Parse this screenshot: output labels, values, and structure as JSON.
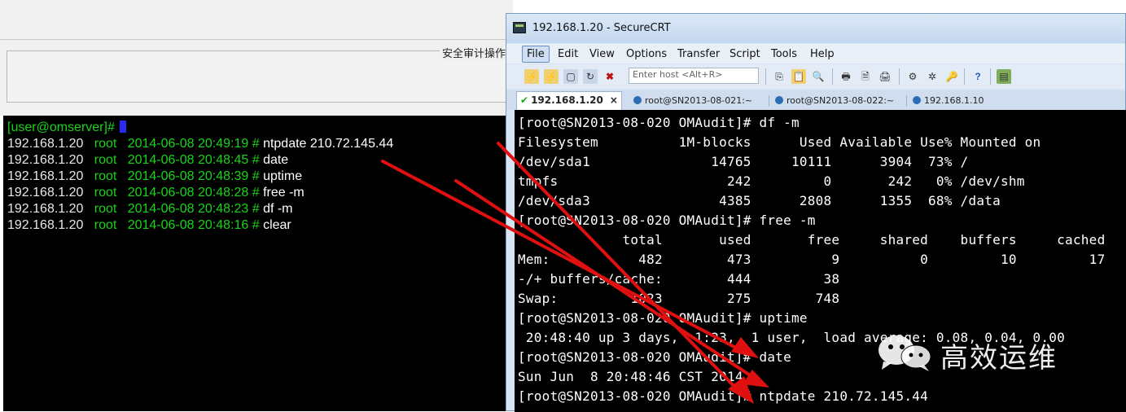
{
  "left_window": {
    "legend": "安全审计操作",
    "prompt": "[user@omserver]#",
    "rows": [
      {
        "ip": "192.168.1.20",
        "user": "root",
        "time": "2014-06-08 20:49:19 #",
        "cmd": "ntpdate 210.72.145.44"
      },
      {
        "ip": "192.168.1.20",
        "user": "root",
        "time": "2014-06-08 20:48:45 #",
        "cmd": "date"
      },
      {
        "ip": "192.168.1.20",
        "user": "root",
        "time": "2014-06-08 20:48:39 #",
        "cmd": "uptime"
      },
      {
        "ip": "192.168.1.20",
        "user": "root",
        "time": "2014-06-08 20:48:28 #",
        "cmd": "free -m"
      },
      {
        "ip": "192.168.1.20",
        "user": "root",
        "time": "2014-06-08 20:48:23 #",
        "cmd": "df -m"
      },
      {
        "ip": "192.168.1.20",
        "user": "root",
        "time": "2014-06-08 20:48:16 #",
        "cmd": "clear"
      }
    ]
  },
  "crt": {
    "title": "192.168.1.20 - SecureCRT",
    "menu": [
      "File",
      "Edit",
      "View",
      "Options",
      "Transfer",
      "Script",
      "Tools",
      "Help"
    ],
    "host_placeholder": "Enter host <Alt+R>",
    "tabs": [
      "192.168.1.20",
      "root@SN2013-08-021:~",
      "root@SN2013-08-022:~",
      "192.168.1.10"
    ],
    "tab_close": "×",
    "terminal_lines": [
      "[root@SN2013-08-020 OMAudit]# df -m",
      "Filesystem          1M-blocks      Used Available Use% Mounted on",
      "/dev/sda1               14765     10111      3904  73% /",
      "tmpfs                     242         0       242   0% /dev/shm",
      "/dev/sda3                4385      2808      1355  68% /data",
      "[root@SN2013-08-020 OMAudit]# free -m",
      "             total       used       free     shared    buffers     cached",
      "Mem:           482        473          9          0         10         17",
      "-/+ buffers/cache:        444         38",
      "Swap:         1023        275        748",
      "[root@SN2013-08-020 OMAudit]# uptime",
      " 20:48:40 up 3 days,  1:23,  1 user,  load average: 0.08, 0.04, 0.00",
      "[root@SN2013-08-020 OMAudit]# date",
      "Sun Jun  8 20:48:46 CST 2014",
      "[root@SN2013-08-020 OMAudit]# ntpdate 210.72.145.44"
    ]
  },
  "watermark": {
    "text": "高效运维"
  },
  "colors": {
    "terminal_bg": "#000000",
    "audit_green": "#18d418",
    "arrow_red": "#e01010"
  }
}
